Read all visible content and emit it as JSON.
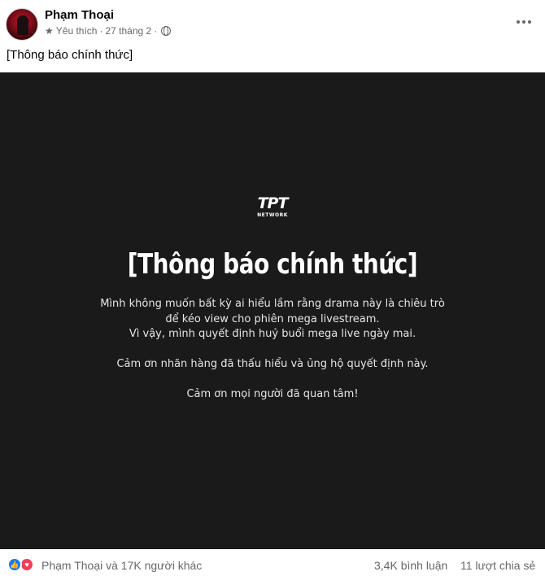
{
  "post": {
    "author": "Phạm Thoại",
    "favorite_label": "Yêu thích",
    "date": "27 tháng 2",
    "separator": "·",
    "text": "[Thông báo chính thức]"
  },
  "image": {
    "logo_mark": "TPT",
    "logo_sub": "NETWORK",
    "heading": "[Thông báo chính thức]",
    "lines": [
      "Mình không muốn bất kỳ ai hiểu lầm rằng drama này là chiêu trò",
      "để kéo view cho phiên mega livestream.",
      "Vì vậy, mình quyết định huỷ buổi mega live ngày mai.",
      "Cảm ơn nhãn hàng đã thấu hiểu và ủng hộ quyết định này.",
      "Cảm ơn mọi người đã quan tâm!"
    ],
    "background": "#1a1a1a"
  },
  "footer": {
    "reactions_text": "Phạm Thoại và 17K người khác",
    "comments": "3,4K bình luận",
    "shares": "11 lượt chia sẻ"
  },
  "colors": {
    "like": "#1877f2",
    "love": "#f33e58",
    "secondary_text": "#65676b"
  },
  "icons": [
    "star-icon",
    "globe-icon",
    "more-icon",
    "like-icon",
    "love-icon"
  ]
}
